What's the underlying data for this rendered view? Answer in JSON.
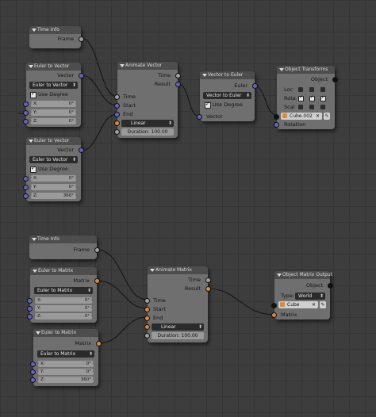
{
  "nodes": {
    "time_info_1": {
      "title": "Time Info",
      "output": "Frame"
    },
    "euler_vec_1": {
      "title": "Euler to Vector",
      "output": "Vector",
      "mode": "Euler to Vector",
      "use_degree": "Use Degree",
      "x_label": "X:",
      "x_value": "0°",
      "y_label": "Y:",
      "y_value": "0°",
      "z_label": "Z:",
      "z_value": "0°"
    },
    "euler_vec_2": {
      "title": "Euler to Vector",
      "output": "Vector",
      "mode": "Euler to Vector",
      "use_degree": "Use Degree",
      "x_label": "X:",
      "x_value": "0°",
      "y_label": "Y:",
      "y_value": "0°",
      "z_label": "Z:",
      "z_value": "360°"
    },
    "animate_vector": {
      "title": "Animate Vector",
      "out_time": "Time",
      "out_result": "Result",
      "in_time": "Time",
      "in_start": "Start",
      "in_end": "End",
      "interp": "Linear",
      "duration_label": "Duration:",
      "duration_value": "100.00"
    },
    "vector_euler": {
      "title": "Vector to Euler",
      "output": "Euler",
      "mode": "Vector to Euler",
      "use_degree": "Use Degree",
      "input": "Vector"
    },
    "object_transforms": {
      "title": "Object Transforms",
      "output": "Object",
      "loc": "Loc",
      "rot": "Rota",
      "scale": "Scal",
      "object_name": "Cube.002",
      "input": "Rotation"
    },
    "time_info_2": {
      "title": "Time Info",
      "output": "Frame"
    },
    "euler_mat_1": {
      "title": "Euler to Matrix",
      "output": "Matrix",
      "mode": "Euler to Matrix",
      "x_label": "X:",
      "x_value": "0°",
      "y_label": "Y:",
      "y_value": "0°",
      "z_label": "Z:",
      "z_value": "0°"
    },
    "euler_mat_2": {
      "title": "Euler to Matrix",
      "output": "Matrix",
      "mode": "Euler to Matrix",
      "x_label": "X:",
      "x_value": "0°",
      "y_label": "Y:",
      "y_value": "0°",
      "z_label": "Z:",
      "z_value": "360°"
    },
    "animate_matrix": {
      "title": "Animate Matrix",
      "out_time": "Time",
      "out_result": "Result",
      "in_time": "Time",
      "in_start": "Start",
      "in_end": "End",
      "interp": "Linear",
      "duration_label": "Duration:",
      "duration_value": "100.00"
    },
    "matrix_output": {
      "title": "Object Matrix Output",
      "output": "Object",
      "type_label": "Type:",
      "type_value": "World",
      "object_name": "Cube",
      "input": "Matrix"
    }
  },
  "colors": {
    "vector_socket": "#6363c7",
    "value_socket": "#a1a1a1",
    "matrix_socket": "#e0883a",
    "wire": "#111111"
  }
}
